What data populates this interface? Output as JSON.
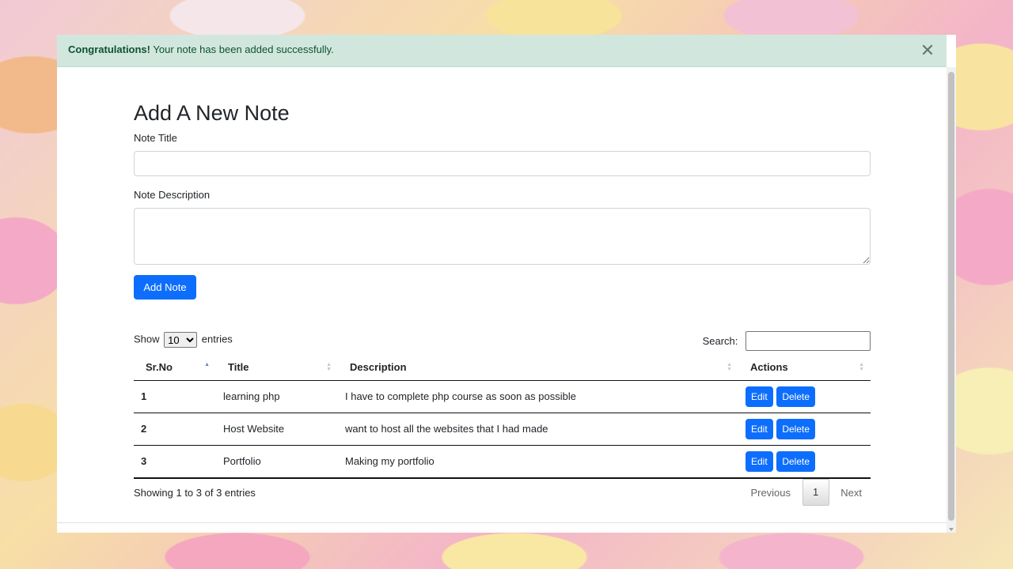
{
  "alert": {
    "strong": "Congratulations!",
    "message": "Your note has been added successfully.",
    "close_glyph": "✕"
  },
  "form": {
    "heading": "Add A New Note",
    "title_label": "Note Title",
    "title_value": "",
    "description_label": "Note Description",
    "description_value": "",
    "submit_label": "Add Note"
  },
  "table_controls": {
    "show_prefix": "Show",
    "show_value": "10",
    "show_suffix": "entries",
    "search_label": "Search:",
    "search_value": ""
  },
  "table": {
    "columns": [
      "Sr.No",
      "Title",
      "Description",
      "Actions"
    ],
    "rows": [
      {
        "srno": "1",
        "title": "learning php",
        "description": "I have to complete php course as soon as possible",
        "edit": "Edit",
        "delete": "Delete"
      },
      {
        "srno": "2",
        "title": "Host Website",
        "description": "want to host all the websites that I had made",
        "edit": "Edit",
        "delete": "Delete"
      },
      {
        "srno": "3",
        "title": "Portfolio",
        "description": "Making my portfolio",
        "edit": "Edit",
        "delete": "Delete"
      }
    ]
  },
  "footer": {
    "info": "Showing 1 to 3 of 3 entries",
    "previous": "Previous",
    "current_page": "1",
    "next": "Next"
  },
  "colors": {
    "primary": "#0d6efd",
    "alert_bg": "#d1e7dd",
    "alert_text": "#0f5132"
  }
}
